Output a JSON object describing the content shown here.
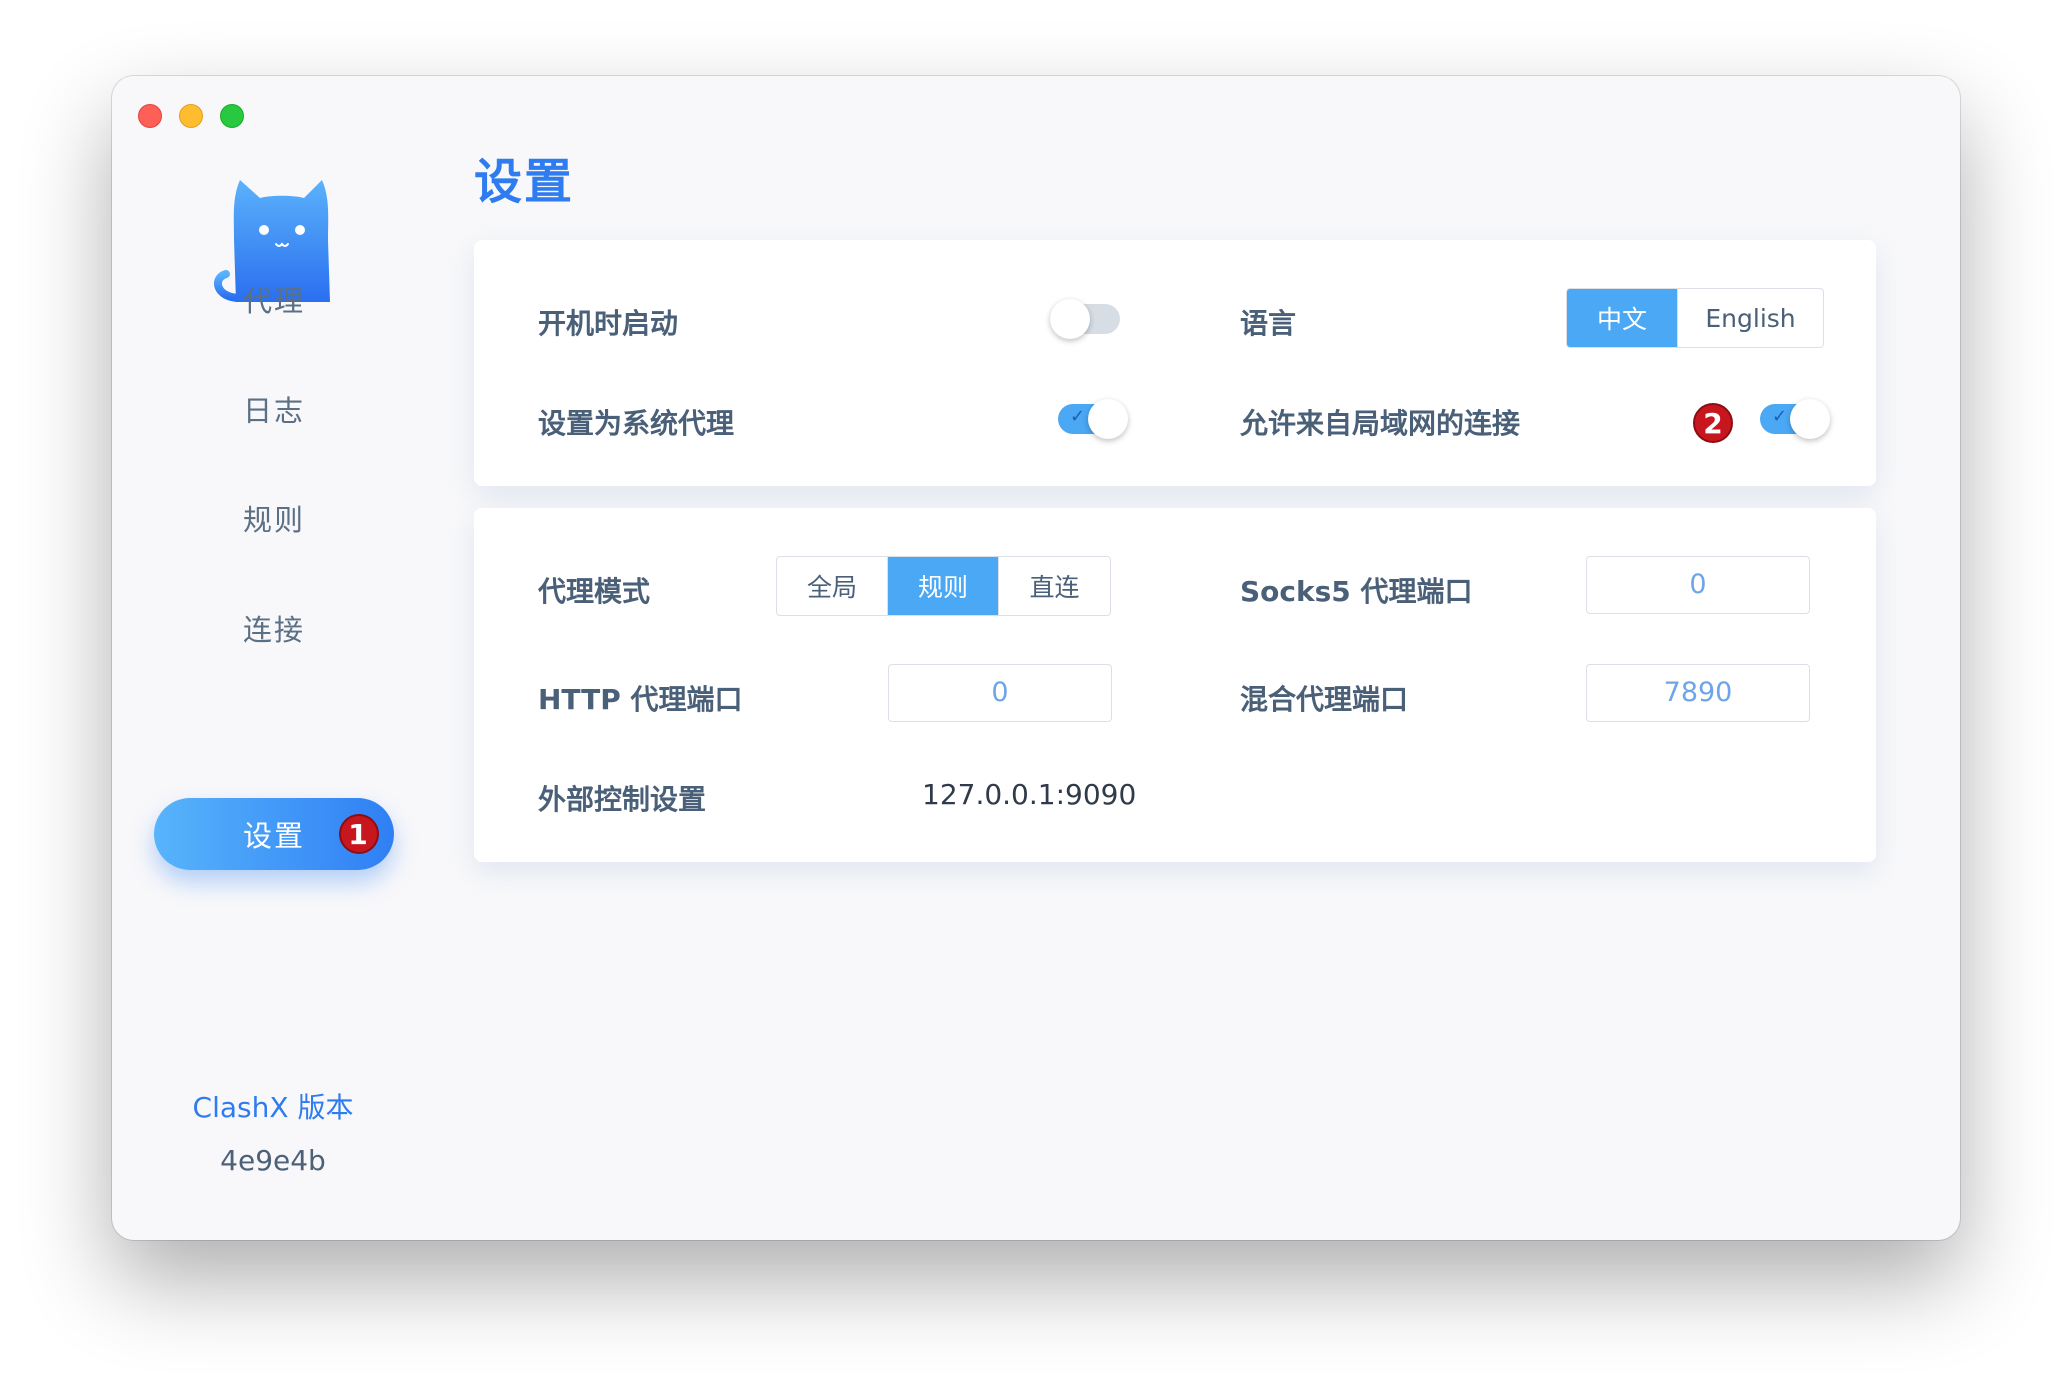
{
  "sidebar": {
    "items": [
      {
        "label": "代理"
      },
      {
        "label": "日志"
      },
      {
        "label": "规则"
      },
      {
        "label": "连接"
      },
      {
        "label": "设置",
        "badge": "1"
      }
    ],
    "version_label": "ClashX 版本",
    "version_value": "4e9e4b"
  },
  "page": {
    "title": "设置"
  },
  "general": {
    "launch_at_login": {
      "label": "开机时启动",
      "on": false
    },
    "system_proxy": {
      "label": "设置为系统代理",
      "on": true
    },
    "language": {
      "label": "语言",
      "options": [
        "中文",
        "English"
      ],
      "selected": "中文"
    },
    "allow_lan": {
      "label": "允许来自局域网的连接",
      "on": true,
      "badge": "2"
    }
  },
  "proxy": {
    "mode": {
      "label": "代理模式",
      "options": [
        "全局",
        "规则",
        "直连"
      ],
      "selected": "规则"
    },
    "socks5_port": {
      "label": "Socks5 代理端口",
      "value": "0"
    },
    "http_port": {
      "label": "HTTP 代理端口",
      "value": "0"
    },
    "mixed_port": {
      "label": "混合代理端口",
      "value": "7890"
    },
    "external_controller": {
      "label": "外部控制设置",
      "value": "127.0.0.1:9090"
    }
  },
  "colors": {
    "accent": "#2e7cf0",
    "toggle_on": "#4aa8f5",
    "badge": "#c8161e"
  }
}
